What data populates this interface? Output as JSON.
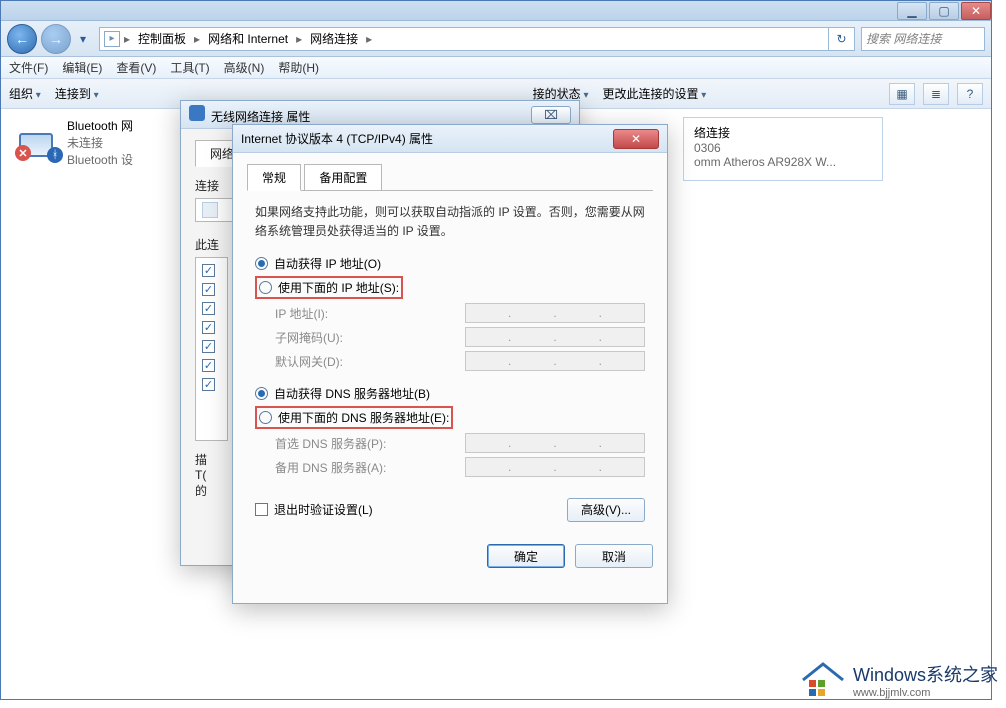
{
  "titlebar": {
    "minimize": "▁",
    "maximize": "▢",
    "close": "✕"
  },
  "breadcrumbs": {
    "root_tip": "▸",
    "items": [
      "控制面板",
      "网络和 Internet",
      "网络连接"
    ]
  },
  "nav": {
    "back": "←",
    "forward": "→",
    "dropdown": "▾",
    "refresh": "↻"
  },
  "search": {
    "placeholder": "搜索 网络连接"
  },
  "menus": [
    "文件(F)",
    "编辑(E)",
    "查看(V)",
    "工具(T)",
    "高级(N)",
    "帮助(H)"
  ],
  "toolbar": {
    "left": [
      "组织",
      "连接到",
      "接的状态",
      "更改此连接的设置"
    ],
    "icons": {
      "view": "▦",
      "list": "≣",
      "help": "?"
    }
  },
  "adapter_left": {
    "line1": "Bluetooth 网",
    "line2": "未连接",
    "line3": "Bluetooth 设",
    "x": "✕",
    "bt": "ᚼ"
  },
  "adapter_right": {
    "line1": "络连接",
    "line2": "0306",
    "line3": "omm Atheros AR928X W..."
  },
  "dlg1": {
    "title": "无线网络连接 属性",
    "close": "⌧",
    "tab": "网络",
    "label_connect": "连接",
    "label_thisconn": "此连",
    "desc_title": "描",
    "desc_l1": "T(",
    "desc_l2": "的"
  },
  "dlg2": {
    "title": "Internet 协议版本 4 (TCP/IPv4) 属性",
    "close": "✕",
    "tabs": [
      "常规",
      "备用配置"
    ],
    "intro": "如果网络支持此功能，则可以获取自动指派的 IP 设置。否则，您需要从网络系统管理员处获得适当的 IP 设置。",
    "ip": {
      "auto": "自动获得 IP 地址(O)",
      "manual": "使用下面的 IP 地址(S):",
      "addr": "IP 地址(I):",
      "mask": "子网掩码(U):",
      "gw": "默认网关(D):"
    },
    "dns": {
      "auto": "自动获得 DNS 服务器地址(B)",
      "manual": "使用下面的 DNS 服务器地址(E):",
      "pref": "首选 DNS 服务器(P):",
      "alt": "备用 DNS 服务器(A):"
    },
    "validate": "退出时验证设置(L)",
    "advanced": "高级(V)...",
    "ok": "确定",
    "cancel": "取消"
  },
  "watermark": {
    "l1": "Windows系统之家",
    "l2": "www.bjjmlv.com"
  }
}
